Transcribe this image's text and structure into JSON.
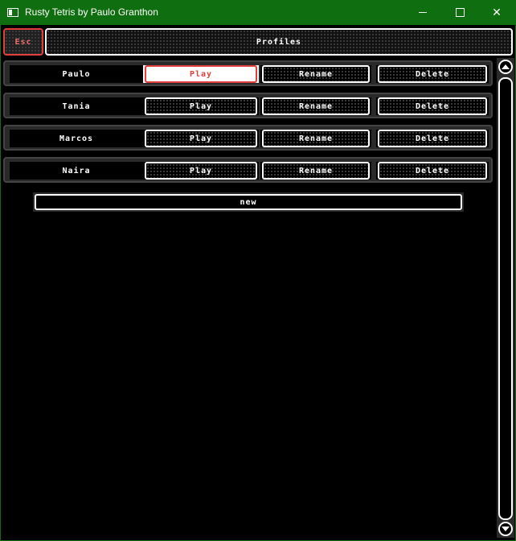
{
  "window": {
    "title": "Rusty Tetris by Paulo Granthon",
    "minimize_glyph": "",
    "close_glyph": "✕"
  },
  "header": {
    "esc_label": "Esc",
    "title": "Profiles"
  },
  "profiles": [
    {
      "name": "Paulo",
      "play": "Play",
      "rename": "Rename",
      "delete": "Delete"
    },
    {
      "name": "Tania",
      "play": "Play",
      "rename": "Rename",
      "delete": "Delete"
    },
    {
      "name": "Marcos",
      "play": "Play",
      "rename": "Rename",
      "delete": "Delete"
    },
    {
      "name": "Naira",
      "play": "Play",
      "rename": "Rename",
      "delete": "Delete"
    }
  ],
  "new_label": "new",
  "colors": {
    "titlebar": "#0f6e0f",
    "accent": "#e0403c",
    "background": "#000000"
  }
}
